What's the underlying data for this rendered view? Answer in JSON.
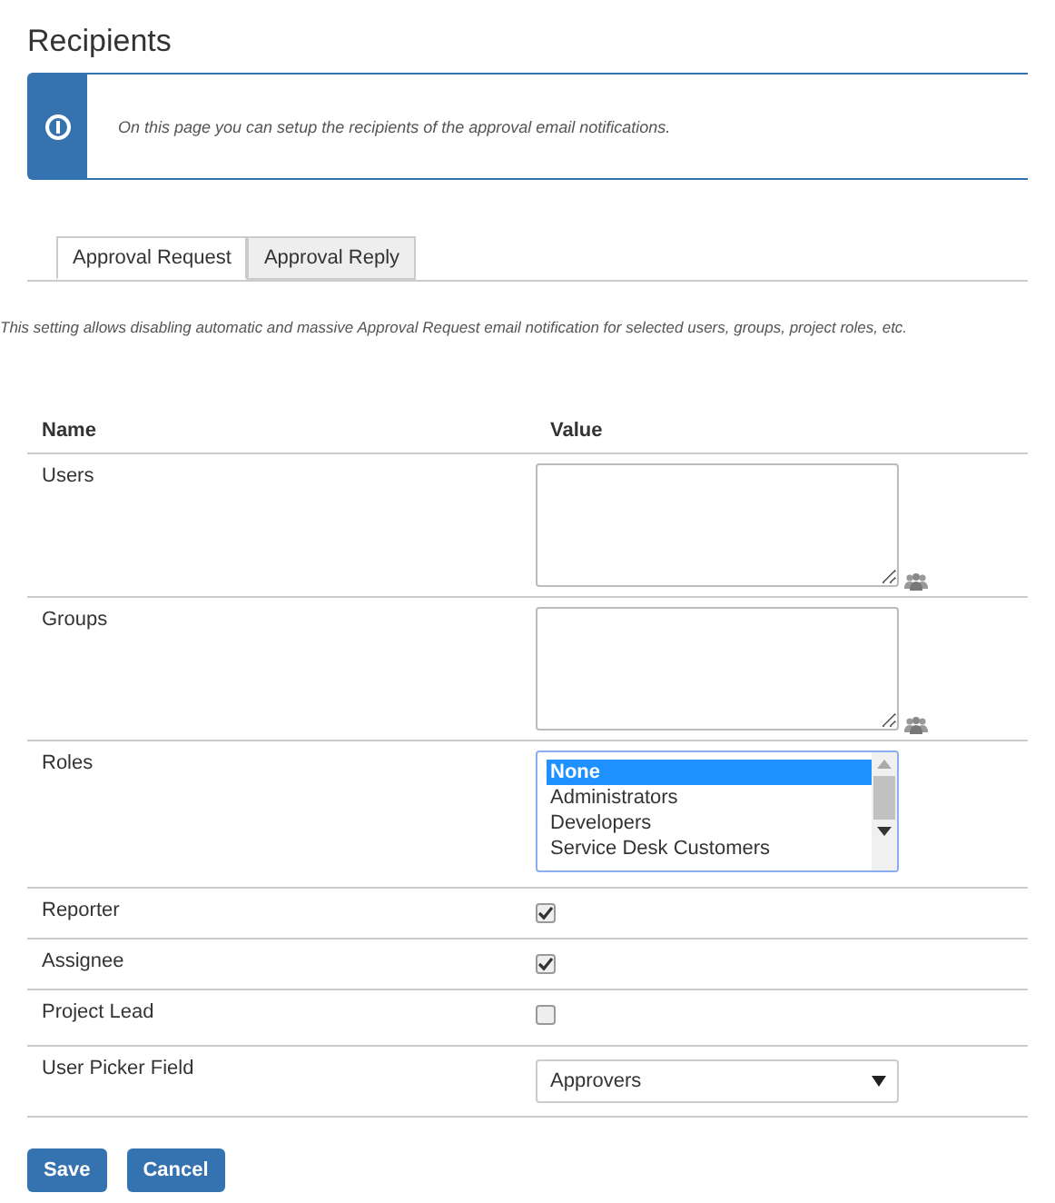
{
  "title": "Recipients",
  "info": {
    "message": "On this page you can setup the recipients of the approval email notifications."
  },
  "tabs": [
    {
      "label": "Approval Request",
      "selected": true
    },
    {
      "label": "Approval Reply",
      "selected": false
    }
  ],
  "description": "This setting allows disabling automatic and massive Approval Request email notification for selected users, groups, project roles, etc.",
  "table": {
    "columns": [
      "Name",
      "Value"
    ],
    "rows": [
      {
        "name": "Users",
        "kind": "textarea"
      },
      {
        "name": "Groups",
        "kind": "textarea"
      },
      {
        "name": "Roles",
        "kind": "listbox",
        "options": [
          {
            "label": "None",
            "selected": true
          },
          {
            "label": "Administrators",
            "selected": false
          },
          {
            "label": "Developers",
            "selected": false
          },
          {
            "label": "Service Desk Customers",
            "selected": false
          }
        ]
      },
      {
        "name": "Reporter",
        "kind": "checkbox",
        "checked": true
      },
      {
        "name": "Assignee",
        "kind": "checkbox",
        "checked": true
      },
      {
        "name": "Project Lead",
        "kind": "checkbox",
        "checked": false
      },
      {
        "name": "User Picker Field",
        "kind": "select",
        "value": "Approvers"
      }
    ]
  },
  "buttons": [
    "Save",
    "Cancel"
  ]
}
